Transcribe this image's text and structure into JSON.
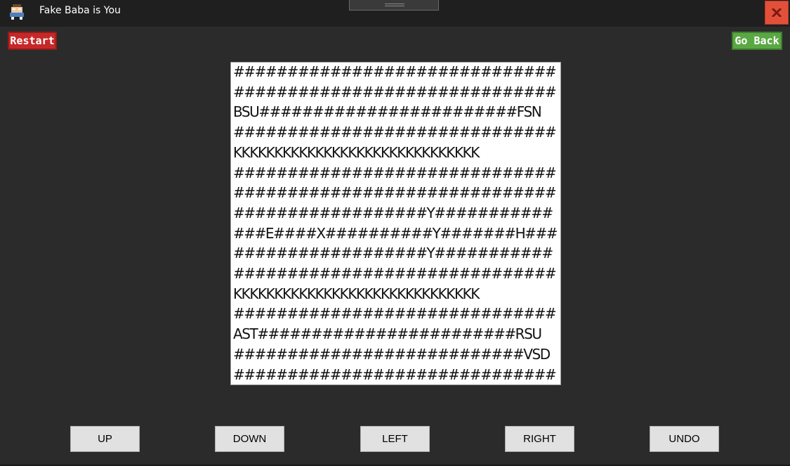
{
  "window": {
    "title": "Fake Baba is You",
    "icon": "baba-sprite-icon",
    "close_icon": "close-x-icon"
  },
  "colors": {
    "restart": "#c62828",
    "go_back": "#5aa844",
    "close": "#e3503a",
    "background": "#2b2b2b"
  },
  "header": {
    "restart_label": "Restart",
    "go_back_label": "Go Back"
  },
  "board": {
    "rows": [
      "##############################",
      "##############################",
      "BSU########################FSN",
      "##############################",
      "KKKKKKKKKKKKKKKKKKKKKKKKKKKKKK",
      "##############################",
      "##############################",
      "##################Y###########",
      "###E####X##########Y#######H###",
      "##################Y###########",
      "##############################",
      "KKKKKKKKKKKKKKKKKKKKKKKKKKKKKK",
      "##############################",
      "AST########################RSU",
      "###########################VSD",
      "##############################"
    ]
  },
  "controls": {
    "up": "UP",
    "down": "DOWN",
    "left": "LEFT",
    "right": "RIGHT",
    "undo": "UNDO"
  }
}
